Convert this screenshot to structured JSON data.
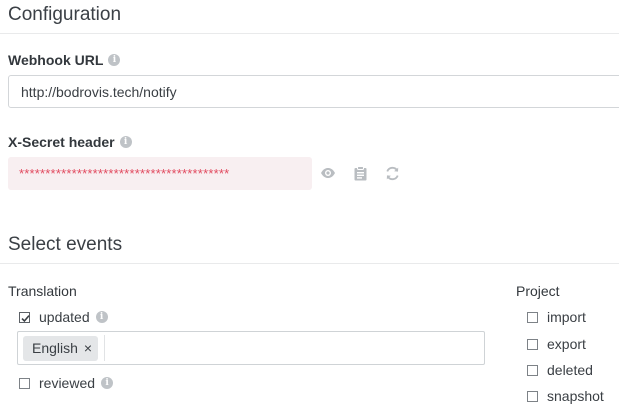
{
  "configuration": {
    "title": "Configuration",
    "webhook_url": {
      "label": "Webhook URL",
      "value": "http://bodrovis.tech/notify"
    },
    "secret_header": {
      "label": "X-Secret header",
      "value": "****************************************",
      "actions": [
        {
          "name": "show-secret-button",
          "icon": "eye-icon"
        },
        {
          "name": "copy-secret-button",
          "icon": "clipboard-icon"
        },
        {
          "name": "regenerate-secret-button",
          "icon": "refresh-icon"
        }
      ]
    }
  },
  "events": {
    "title": "Select events",
    "translation": {
      "label": "Translation",
      "updated": {
        "label": "updated",
        "checked": true
      },
      "languages": [
        "English"
      ],
      "reviewed": {
        "label": "reviewed",
        "checked": false
      }
    },
    "project": {
      "label": "Project",
      "items": [
        {
          "label": "import",
          "checked": false
        },
        {
          "label": "export",
          "checked": false
        },
        {
          "label": "deleted",
          "checked": false
        },
        {
          "label": "snapshot",
          "checked": false
        }
      ]
    }
  },
  "icons": {
    "info": "i",
    "tag_remove": "×"
  },
  "colors": {
    "secret_text": "#e14a5f",
    "secret_bg": "#f8eff1",
    "icon_gray": "#b9bdc1"
  }
}
